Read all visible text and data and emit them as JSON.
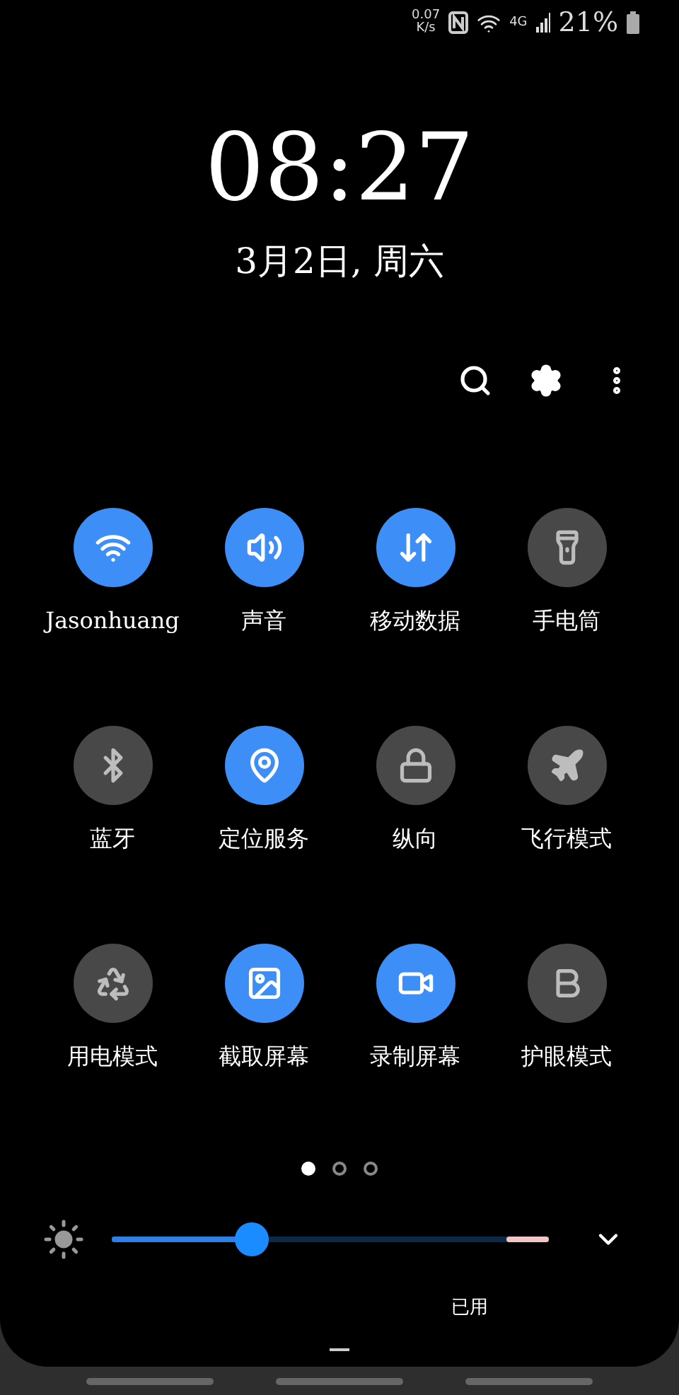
{
  "status_bar": {
    "speed_value": "0.07",
    "speed_unit": "K/s",
    "network": "4G",
    "battery": "21%"
  },
  "clock": {
    "time": "08:27",
    "date": "3月2日, 周六"
  },
  "tiles": [
    {
      "kind": "wifi",
      "label": "Jasonhuang",
      "on": true
    },
    {
      "kind": "sound",
      "label": "声音",
      "on": true
    },
    {
      "kind": "data",
      "label": "移动数据",
      "on": true
    },
    {
      "kind": "flashlight",
      "label": "手电筒",
      "on": false
    },
    {
      "kind": "bluetooth",
      "label": "蓝牙",
      "on": false
    },
    {
      "kind": "location",
      "label": "定位服务",
      "on": true
    },
    {
      "kind": "portrait",
      "label": "纵向",
      "on": false
    },
    {
      "kind": "airplane",
      "label": "飞行模式",
      "on": false
    },
    {
      "kind": "power",
      "label": "用电模式",
      "on": false
    },
    {
      "kind": "screenshot",
      "label": "截取屏幕",
      "on": true
    },
    {
      "kind": "record",
      "label": "录制屏幕",
      "on": true
    },
    {
      "kind": "eyecare",
      "label": "护眼模式",
      "on": false
    }
  ],
  "pages": [
    {
      "selected": true
    },
    {
      "selected": false
    },
    {
      "selected": false
    }
  ],
  "brightness": {
    "level": 0.32
  },
  "footer": "已用"
}
